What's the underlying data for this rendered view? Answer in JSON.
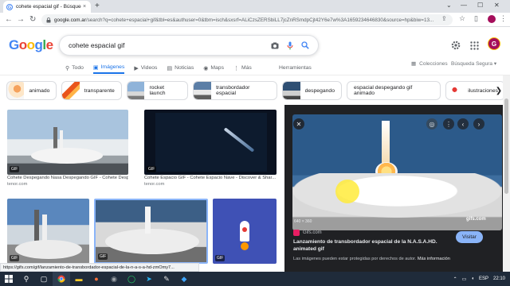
{
  "browser": {
    "tab_title": "cohete espacial gif - Búsqueda d",
    "tab_close": "×",
    "new_tab": "+",
    "url_host": "google.com.ar",
    "url_path": "/search?q=cohete+espacial+gif&tbl=es&authuser=0&tbm=isch&sxsrf=ALiCzsZERSbiLL7jcZnRSmdpCjt42Y6e7w%3A1659234646830&source=hp&biw=13...",
    "nav_back": "←",
    "nav_forward": "→",
    "nav_reload": "↻",
    "window_minimize": "—",
    "window_maximize": "☐",
    "window_close": "✕",
    "collapse": "⌄"
  },
  "google": {
    "logo": [
      "G",
      "o",
      "o",
      "g",
      "l",
      "e"
    ],
    "logo_colors": [
      "#4285f4",
      "#ea4335",
      "#fbbc05",
      "#4285f4",
      "#34a853",
      "#ea4335"
    ],
    "query": "cohete espacial gif",
    "avatar_letter": "G"
  },
  "search_tabs": [
    {
      "label": "Todo",
      "icon": "search-icon",
      "glyph": "⚲",
      "active": false
    },
    {
      "label": "Imágenes",
      "icon": "image-icon",
      "glyph": "▣",
      "active": true
    },
    {
      "label": "Videos",
      "icon": "video-icon",
      "glyph": "▶",
      "active": false
    },
    {
      "label": "Noticias",
      "icon": "news-icon",
      "glyph": "▤",
      "active": false
    },
    {
      "label": "Maps",
      "icon": "map-pin-icon",
      "glyph": "◉",
      "active": false
    },
    {
      "label": "Más",
      "icon": "more-vert-icon",
      "glyph": "⋮",
      "active": false
    }
  ],
  "tools_label": "Herramientas",
  "collections_label": "Colecciones",
  "safesearch_label": "Búsqueda Segura ▾",
  "chips": [
    {
      "label": "animado"
    },
    {
      "label": "transparente"
    },
    {
      "label": "rocket launch"
    },
    {
      "label": "transbordador espacial"
    },
    {
      "label": "despegando"
    },
    {
      "label": "espacial despegando gif animado"
    },
    {
      "label": "ilustraciones"
    }
  ],
  "chip_next": "❯",
  "results": [
    {
      "caption": "Cohete Despegando Nasa Despegando GIF - Cohete Despeg...",
      "source": "tenor.com",
      "badge": "GIF"
    },
    {
      "caption": "Cohete Espacio GIF - Cohete Espacio Nave - Discover & Shar...",
      "source": "tenor.com",
      "badge": "GIF"
    },
    {
      "badge": "GIF"
    },
    {
      "badge": "GIF"
    },
    {
      "badge": "GIF"
    }
  ],
  "preview": {
    "dims": "640 × 360",
    "watermark": "gifs.com",
    "source": "Gifs.com",
    "title": "Lanzamiento de transbordador espacial de la N.A.S.A.HD. animated gif",
    "visit": "Visitar",
    "note_prefix": "Las imágenes pueden estar protegidas por derechos de autor.",
    "note_link": "Más información",
    "close": "✕",
    "prev": "‹",
    "next": "›",
    "more": "⋮"
  },
  "status_url": "https://gifs.com/gif/lanzamiento-de-transbordador-espacial-de-la-n-a-s-a-hd-zmOmy7...",
  "taskbar": {
    "lang": "ESP",
    "time": "22:10"
  }
}
